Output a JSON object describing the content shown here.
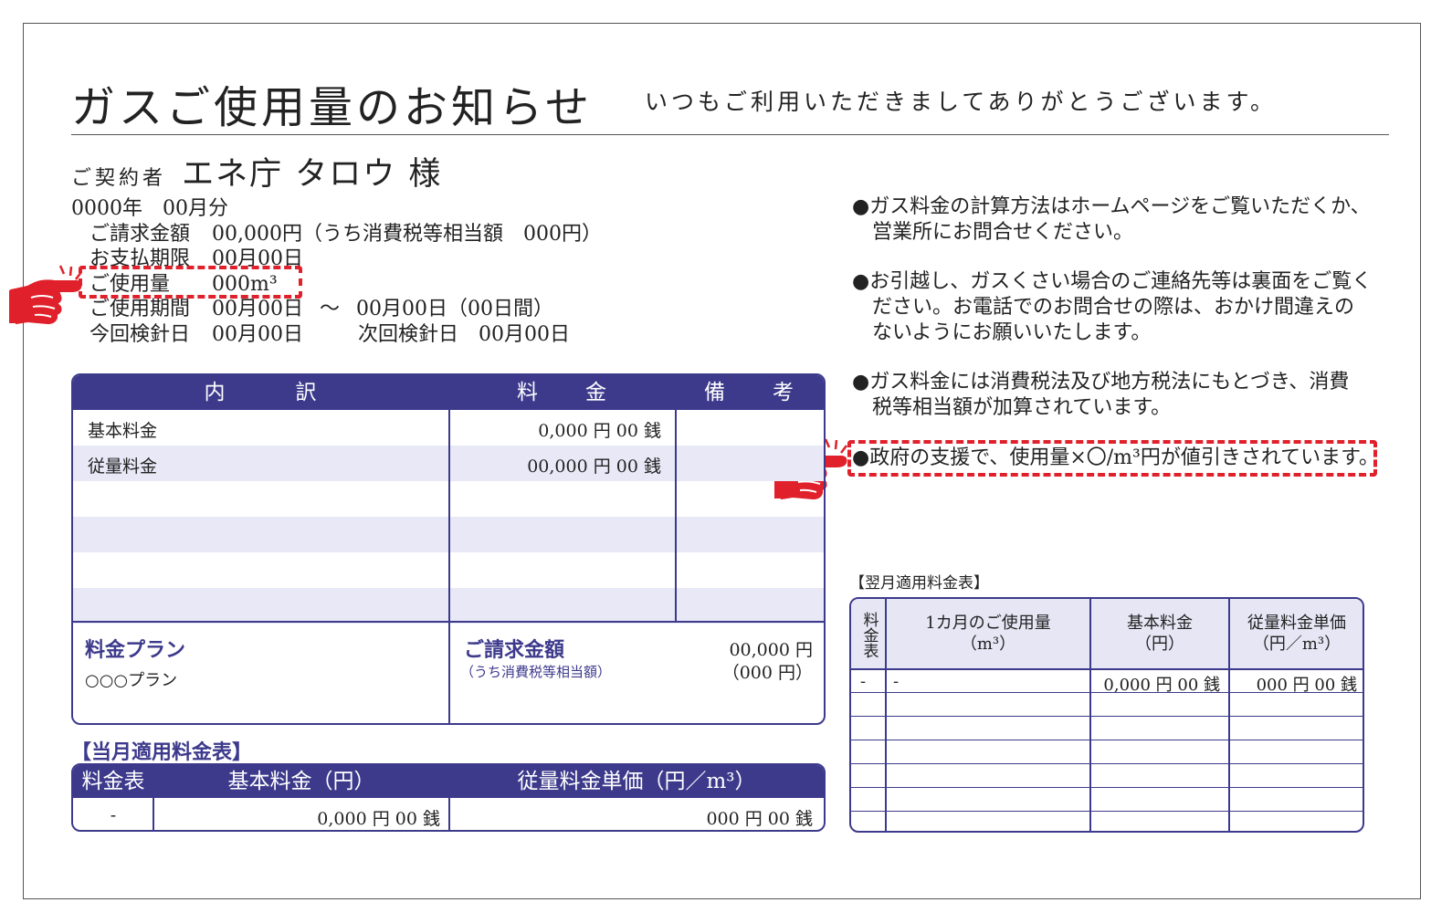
{
  "header": {
    "title": "ガスご使用量のお知らせ",
    "subtitle": "いつもご利用いただきましてありがとうございます。"
  },
  "contractor": {
    "label": "ご契約者",
    "name": "エネ庁 タロウ 様"
  },
  "info": {
    "period": "0000年　00月分",
    "billing_label": "ご請求金額",
    "billing_value": "00,000円（うち消費税等相当額　000円）",
    "due_label": "お支払期限",
    "due_value": "00月00日",
    "usage_label": "ご使用量",
    "usage_value": "000m³",
    "usage_period_label": "ご使用期間",
    "usage_period_from": "00月00日",
    "usage_period_sep": "～",
    "usage_period_to": "00月00日（00日間）",
    "reading_label": "今回検針日",
    "reading_value": "00月00日",
    "next_reading_label": "次回検針日",
    "next_reading_value": "00月00日"
  },
  "notes": [
    {
      "line1": "●ガス料金の計算方法はホームページをご覧いただくか、",
      "line2": "営業所にお問合せください。",
      "line3": ""
    },
    {
      "line1": "●お引越し、ガスくさい場合のご連絡先等は裏面をご覧く",
      "line2": "ださい。お電話でのお問合せの際は、おかけ間違えの",
      "line3": "ないようにお願いいたします。"
    },
    {
      "line1": "●ガス料金には消費税法及び地方税法にもとづき、消費",
      "line2": "税等相当額が加算されています。",
      "line3": ""
    },
    {
      "line1": "●政府の支援で、使用量×〇/m³円が値引きされています。",
      "line2": "",
      "line3": ""
    }
  ],
  "main_table": {
    "headers": [
      "内　　　訳",
      "料　　金",
      "備　　考"
    ],
    "rows": [
      {
        "item": "基本料金",
        "amount": "0,000 円 00 銭",
        "note": ""
      },
      {
        "item": "従量料金",
        "amount": "00,000 円 00 銭",
        "note": ""
      }
    ],
    "plan_label": "料金プラン",
    "plan_value": "○○○プラン",
    "bill_label": "ご請求金額",
    "bill_tax_label": "（うち消費税等相当額）",
    "bill_value": "00,000 円",
    "bill_tax_value": "（000 円）"
  },
  "current_table": {
    "title": "【当月適用料金表】",
    "headers": [
      "料金表",
      "基本料金（円）",
      "従量料金単価（円／m³）"
    ],
    "row": [
      "-",
      "0,000 円 00 銭",
      "000 円 00 銭"
    ]
  },
  "next_table": {
    "title": "【翌月適用料金表】",
    "headers": [
      "料金表",
      "1カ月のご使用量",
      "（m³）",
      "基本料金",
      "（円）",
      "従量料金単価",
      "（円／m³）"
    ],
    "row": [
      "-",
      "-",
      "0,000 円 00 銭",
      "000 円 00 銭"
    ]
  },
  "colors": {
    "accent": "#3d3a8c",
    "highlight": "#e0202a",
    "shade": "#e8e8f7"
  }
}
